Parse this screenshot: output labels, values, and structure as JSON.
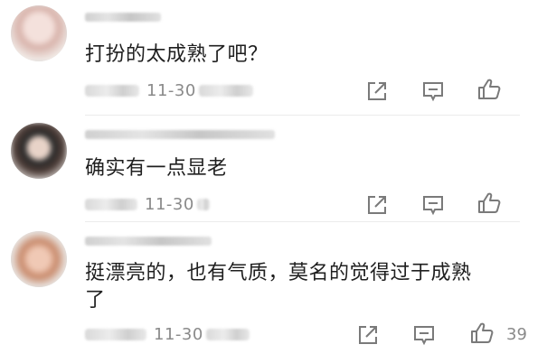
{
  "comments": [
    {
      "text": "打扮的太成熟了吧？",
      "date": "11-30",
      "like_count": "",
      "icons": {
        "share": "share-icon",
        "reply": "comment-icon",
        "like": "thumbs-up-icon"
      }
    },
    {
      "text": "确实有一点显老",
      "date": "11-30",
      "like_count": "",
      "icons": {
        "share": "share-icon",
        "reply": "comment-icon",
        "like": "thumbs-up-icon"
      }
    },
    {
      "text_line1": "挺漂亮的，也有气质，莫名的觉得过于成熟",
      "text_line2": "了",
      "date": "11-30",
      "like_count": "39",
      "icons": {
        "share": "share-icon",
        "reply": "comment-icon",
        "like": "thumbs-up-icon"
      }
    }
  ],
  "colors": {
    "meta": "#8a8a8a",
    "text": "#1f1f1f",
    "icon": "#7a7a7a"
  }
}
